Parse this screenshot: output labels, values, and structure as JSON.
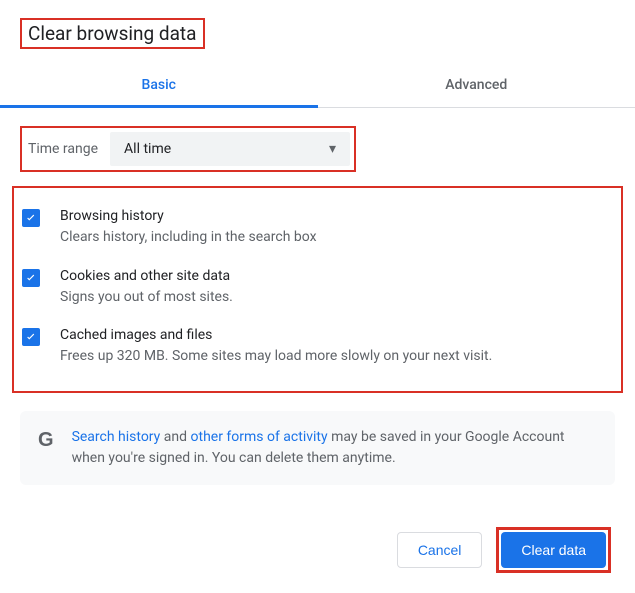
{
  "dialog": {
    "title": "Clear browsing data"
  },
  "tabs": {
    "basic": "Basic",
    "advanced": "Advanced"
  },
  "time": {
    "label": "Time range",
    "value": "All time"
  },
  "options": [
    {
      "title": "Browsing history",
      "desc": "Clears history, including in the search box"
    },
    {
      "title": "Cookies and other site data",
      "desc": "Signs you out of most sites."
    },
    {
      "title": "Cached images and files",
      "desc": "Frees up 320 MB. Some sites may load more slowly on your next visit."
    }
  ],
  "info": {
    "link1": "Search history",
    "mid1": " and ",
    "link2": "other forms of activity",
    "rest": " may be saved in your Google Account when you're signed in. You can delete them anytime."
  },
  "buttons": {
    "cancel": "Cancel",
    "clear": "Clear data"
  }
}
